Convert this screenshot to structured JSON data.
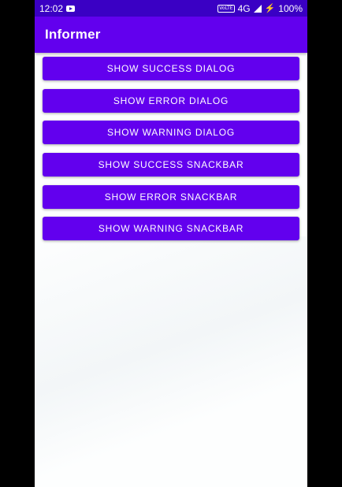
{
  "status_bar": {
    "time": "12:02",
    "volte": "VoLTE",
    "network": "4G",
    "battery": "100%"
  },
  "app_bar": {
    "title": "Informer"
  },
  "buttons": [
    {
      "label": "Show Success Dialog"
    },
    {
      "label": "Show Error Dialog"
    },
    {
      "label": "Show Warning Dialog"
    },
    {
      "label": "Show Success Snackbar"
    },
    {
      "label": "Show Error Snackbar"
    },
    {
      "label": "Show Warning Snackbar"
    }
  ],
  "colors": {
    "primary": "#6200ee",
    "primary_dark": "#3a00c4",
    "background": "#fdfefe"
  }
}
